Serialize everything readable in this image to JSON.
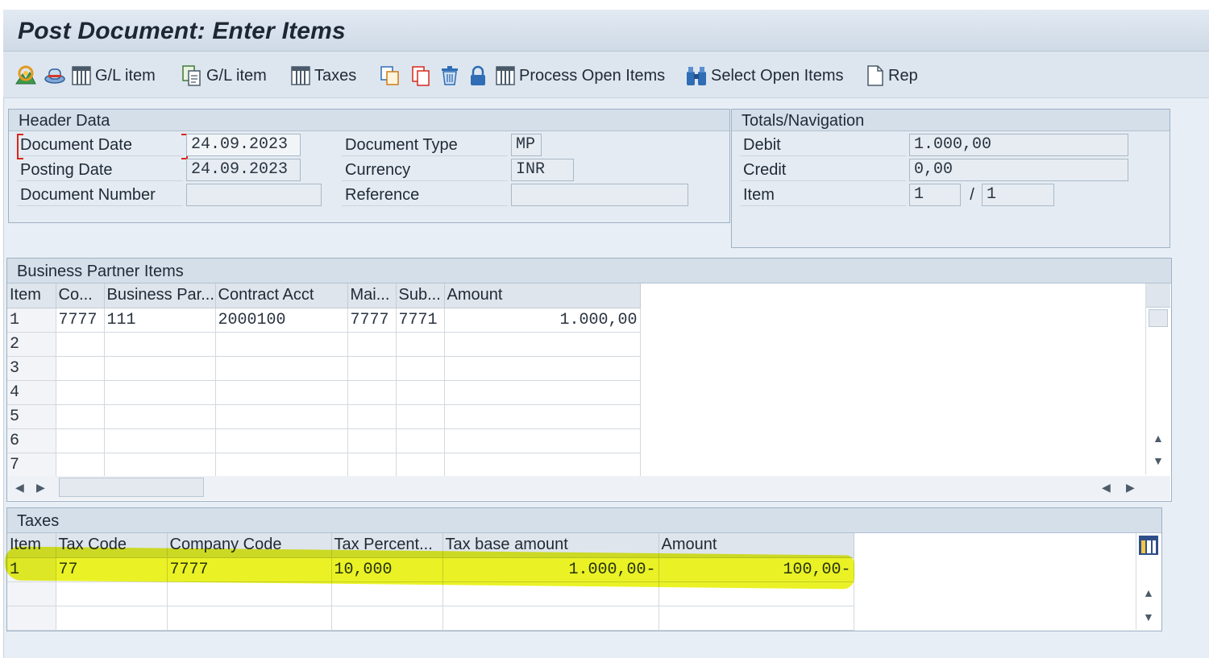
{
  "window": {
    "title": "Post Document: Enter Items"
  },
  "toolbar": {
    "gl_item_1": "G/L item",
    "gl_item_2": "G/L item",
    "taxes": "Taxes",
    "process_open_items": "Process Open Items",
    "select_open_items": "Select Open Items",
    "rep": "Rep"
  },
  "header_data": {
    "title": "Header Data",
    "document_date_label": "Document Date",
    "document_date": "24.09.2023",
    "posting_date_label": "Posting Date",
    "posting_date": "24.09.2023",
    "document_number_label": "Document Number",
    "document_number": "",
    "document_type_label": "Document Type",
    "document_type": "MP",
    "currency_label": "Currency",
    "currency": "INR",
    "reference_label": "Reference",
    "reference": ""
  },
  "totals": {
    "title": "Totals/Navigation",
    "debit_label": "Debit",
    "debit": "1.000,00",
    "credit_label": "Credit",
    "credit": "0,00",
    "item_label": "Item",
    "item_current": "1",
    "separator": "/",
    "item_total": "1"
  },
  "bp_items": {
    "title": "Business Partner Items",
    "columns": [
      "Item",
      "Co...",
      "Business Par...",
      "Contract Acct",
      "Mai...",
      "Sub...",
      "Amount"
    ],
    "rows": [
      [
        "1",
        "7777",
        "111",
        "2000100",
        "7777",
        "7771",
        "1.000,00"
      ],
      [
        "2",
        "",
        "",
        "",
        "",
        "",
        ""
      ],
      [
        "3",
        "",
        "",
        "",
        "",
        "",
        ""
      ],
      [
        "4",
        "",
        "",
        "",
        "",
        "",
        ""
      ],
      [
        "5",
        "",
        "",
        "",
        "",
        "",
        ""
      ],
      [
        "6",
        "",
        "",
        "",
        "",
        "",
        ""
      ],
      [
        "7",
        "",
        "",
        "",
        "",
        "",
        ""
      ]
    ]
  },
  "taxes": {
    "title": "Taxes",
    "columns": [
      "Item",
      "Tax Code",
      "Company Code",
      "Tax Percent...",
      "Tax base amount",
      "Amount"
    ],
    "rows": [
      [
        "1",
        "77",
        "7777",
        "10,000",
        "1.000,00-",
        "100,00-"
      ],
      [
        "",
        "",
        "",
        "",
        "",
        ""
      ],
      [
        "",
        "",
        "",
        "",
        "",
        ""
      ]
    ]
  },
  "colors": {
    "highlight": "#e6f000",
    "required": "#d8281c",
    "accent": "#2f6db5"
  }
}
